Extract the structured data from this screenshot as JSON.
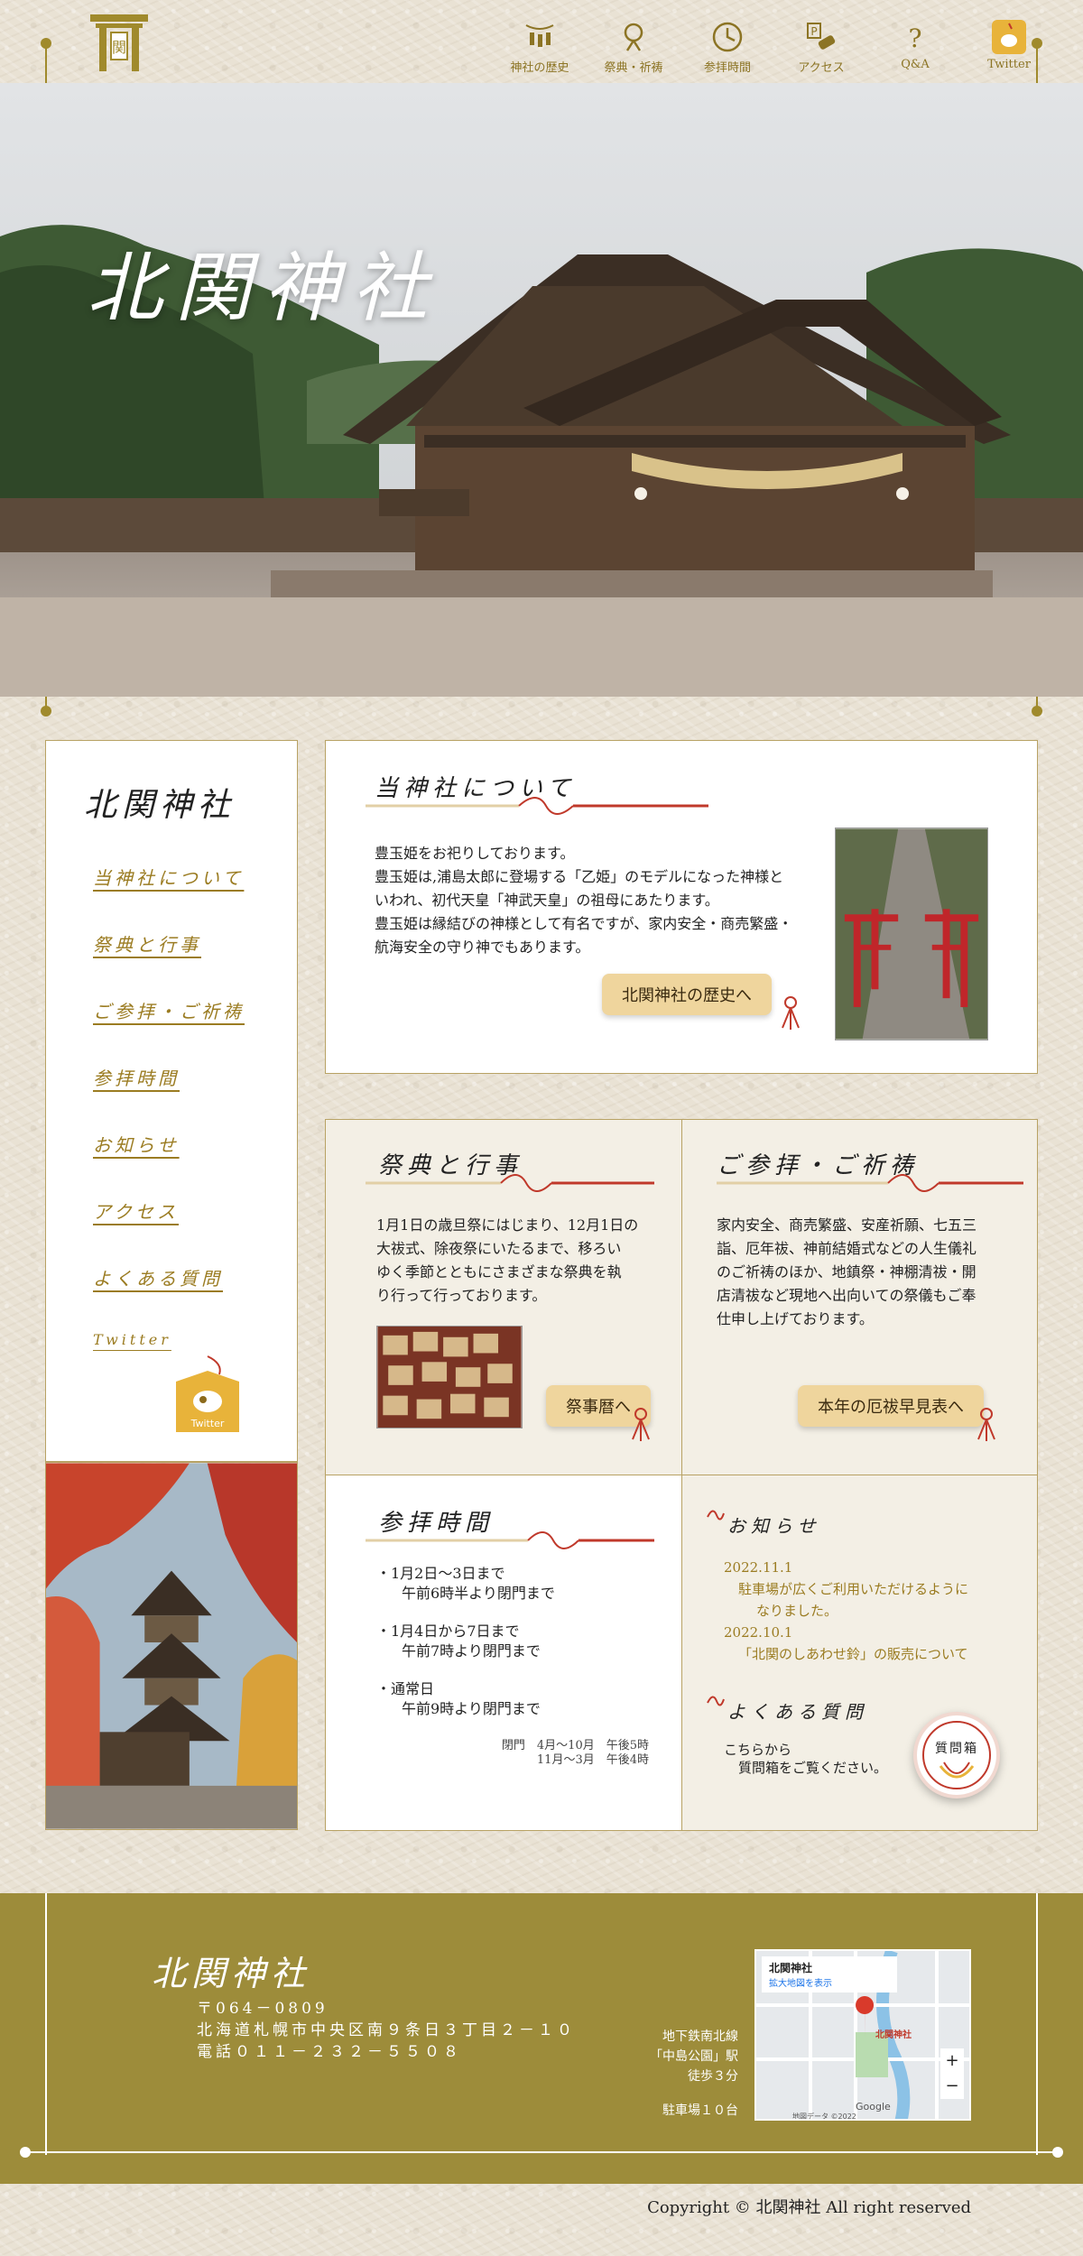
{
  "header": {
    "logo_char": "関",
    "nav": [
      {
        "label": "神社の歴史",
        "icon": "lanterns-icon"
      },
      {
        "label": "祭典・祈祷",
        "icon": "bell-icon"
      },
      {
        "label": "参拝時間",
        "icon": "clock-icon"
      },
      {
        "label": "アクセス",
        "icon": "car-parking-icon"
      },
      {
        "label": "Q&A",
        "icon": "question-icon"
      },
      {
        "label": "Twitter",
        "icon": "twitter-bird-icon"
      }
    ]
  },
  "hero": {
    "title": "北関神社"
  },
  "sidebar": {
    "brand": "北関神社",
    "links": [
      "当神社について",
      "祭典と行事",
      "ご参拝・ご祈祷",
      "参拝時間",
      "お知らせ",
      "アクセス",
      "よくある質問",
      "Twitter"
    ],
    "twitter_badge": "Twitter"
  },
  "about": {
    "title": "当神社について",
    "lines": [
      "豊玉姫をお祀りしております。",
      "豊玉姫は,浦島太郎に登場する「乙姫」のモデルになった神様と",
      "いわれ、初代天皇「神武天皇」の祖母にあたります。",
      "豊玉姫は縁結びの神様として有名ですが、家内安全・商売繁盛・",
      "航海安全の守り神でもあります。"
    ],
    "button": "北関神社の歴史へ"
  },
  "festivals": {
    "title": "祭典と行事",
    "lines": [
      "1月1日の歳旦祭にはじまり、12月1日の",
      "大祓式、除夜祭にいたるまで、移ろい",
      "ゆく季節とともにさまざまな祭典を執",
      "り行って行っております。"
    ],
    "button": "祭事暦へ"
  },
  "prayers": {
    "title": "ご参拝・ご祈祷",
    "lines": [
      "家内安全、商売繁盛、安産祈願、七五三",
      "詣、厄年祓、神前結婚式などの人生儀礼",
      "のご祈祷のほか、地鎮祭・神棚清祓・開",
      "店清祓など現地へ出向いての祭儀もご奉",
      "仕申し上げております。"
    ],
    "button": "本年の厄祓早見表へ"
  },
  "hours": {
    "title": "参拝時間",
    "items": [
      {
        "head": "・1月2日～3日まで",
        "sub": "午前6時半より閉門まで"
      },
      {
        "head": "・1月4日から7日まで",
        "sub": "午前7時より閉門まで"
      },
      {
        "head": "・通常日",
        "sub": "午前9時より閉門まで"
      }
    ],
    "closing_1": "閉門　4月～10月　午後5時",
    "closing_2": "11月～3月　午後4時"
  },
  "news": {
    "title": "お知らせ",
    "items": [
      {
        "date": "2022.11.1",
        "text": "駐車場が広くご利用いただけるように",
        "text2": "なりました。"
      },
      {
        "date": "2022.10.1",
        "text": "「北関のしあわせ鈴」の販売について",
        "text2": ""
      }
    ],
    "faq_title": "よくある質問",
    "faq_line1": "こちらから",
    "faq_line2": "質問箱をご覧ください。",
    "faq_badge": "質問箱"
  },
  "footer": {
    "brand": "北関神社",
    "postal": "〒064－0809",
    "address": "北海道札幌市中央区南９条日３丁目２－１０",
    "phone": "電話０１１－２３２－５５０８",
    "access_1": "地下鉄南北線",
    "access_2": "「中島公園」駅",
    "access_3": "徒歩３分",
    "parking": "駐車場１０台",
    "map_title": "北関神社",
    "map_sub": "拡大地図を表示",
    "map_pin": "北関神社",
    "map_brand": "Google",
    "map_credit": "地図データ ©2022"
  },
  "copyright": "Copyright © 北関神社  All right reserved"
}
